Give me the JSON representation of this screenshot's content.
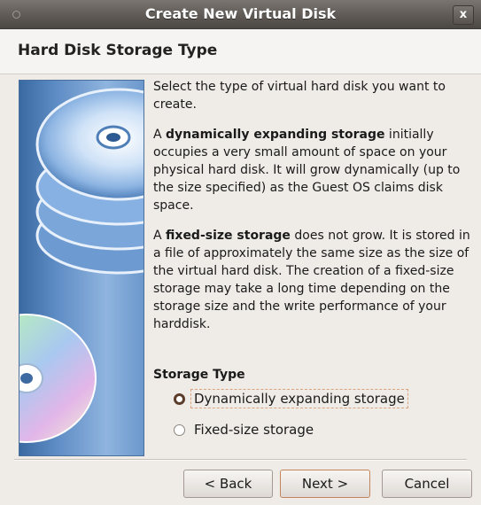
{
  "window": {
    "title": "Create New Virtual Disk",
    "close_label": "x"
  },
  "header": {
    "heading": "Hard Disk Storage Type"
  },
  "content": {
    "intro": "Select the type of virtual hard disk you want to create.",
    "dynamic_bold": "dynamically expanding storage",
    "dynamic_pre": "A ",
    "dynamic_post": " initially occupies a very small amount of space on your physical hard disk. It will grow dynamically (up to the size specified) as the Guest OS claims disk space.",
    "fixed_pre": "A ",
    "fixed_bold": "fixed-size storage",
    "fixed_post": " does not grow. It is stored in a file of approximately the same size as the size of the virtual hard disk. The creation of a fixed-size storage may take a long time depending on the storage size and the write performance of your harddisk."
  },
  "storage_type": {
    "label": "Storage Type",
    "options": [
      {
        "label": "Dynamically expanding storage",
        "selected": true
      },
      {
        "label": "Fixed-size storage",
        "selected": false
      }
    ]
  },
  "buttons": {
    "back_label": "< Back",
    "next_label": "Next >",
    "cancel_label": "Cancel"
  },
  "colors": {
    "accent": "#c4855d",
    "titlebar": "#5f5a55",
    "side_image_blue": "#5e8cc4"
  },
  "icons": {
    "side_image": "stacked-disks-image"
  }
}
